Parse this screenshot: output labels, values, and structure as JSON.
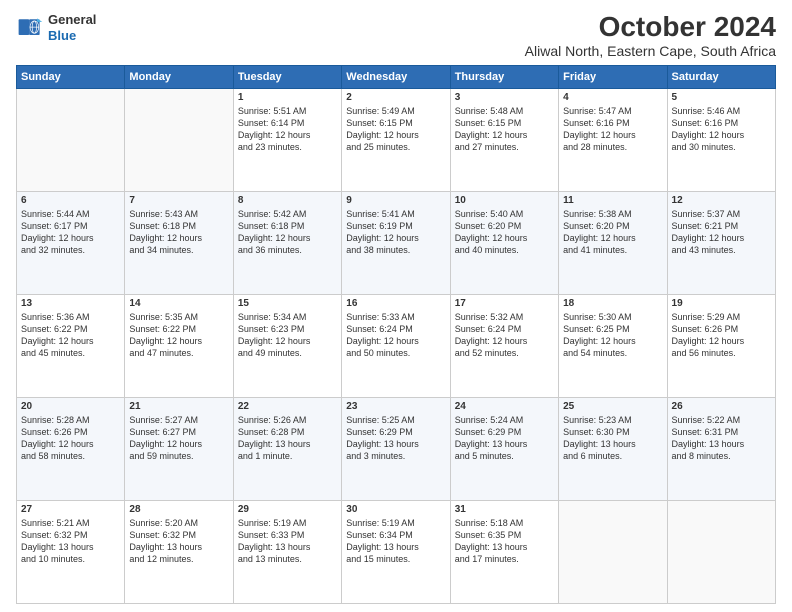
{
  "logo": {
    "line1": "General",
    "line2": "Blue"
  },
  "title": "October 2024",
  "subtitle": "Aliwal North, Eastern Cape, South Africa",
  "headers": [
    "Sunday",
    "Monday",
    "Tuesday",
    "Wednesday",
    "Thursday",
    "Friday",
    "Saturday"
  ],
  "weeks": [
    [
      {
        "day": "",
        "text": ""
      },
      {
        "day": "",
        "text": ""
      },
      {
        "day": "1",
        "text": "Sunrise: 5:51 AM\nSunset: 6:14 PM\nDaylight: 12 hours\nand 23 minutes."
      },
      {
        "day": "2",
        "text": "Sunrise: 5:49 AM\nSunset: 6:15 PM\nDaylight: 12 hours\nand 25 minutes."
      },
      {
        "day": "3",
        "text": "Sunrise: 5:48 AM\nSunset: 6:15 PM\nDaylight: 12 hours\nand 27 minutes."
      },
      {
        "day": "4",
        "text": "Sunrise: 5:47 AM\nSunset: 6:16 PM\nDaylight: 12 hours\nand 28 minutes."
      },
      {
        "day": "5",
        "text": "Sunrise: 5:46 AM\nSunset: 6:16 PM\nDaylight: 12 hours\nand 30 minutes."
      }
    ],
    [
      {
        "day": "6",
        "text": "Sunrise: 5:44 AM\nSunset: 6:17 PM\nDaylight: 12 hours\nand 32 minutes."
      },
      {
        "day": "7",
        "text": "Sunrise: 5:43 AM\nSunset: 6:18 PM\nDaylight: 12 hours\nand 34 minutes."
      },
      {
        "day": "8",
        "text": "Sunrise: 5:42 AM\nSunset: 6:18 PM\nDaylight: 12 hours\nand 36 minutes."
      },
      {
        "day": "9",
        "text": "Sunrise: 5:41 AM\nSunset: 6:19 PM\nDaylight: 12 hours\nand 38 minutes."
      },
      {
        "day": "10",
        "text": "Sunrise: 5:40 AM\nSunset: 6:20 PM\nDaylight: 12 hours\nand 40 minutes."
      },
      {
        "day": "11",
        "text": "Sunrise: 5:38 AM\nSunset: 6:20 PM\nDaylight: 12 hours\nand 41 minutes."
      },
      {
        "day": "12",
        "text": "Sunrise: 5:37 AM\nSunset: 6:21 PM\nDaylight: 12 hours\nand 43 minutes."
      }
    ],
    [
      {
        "day": "13",
        "text": "Sunrise: 5:36 AM\nSunset: 6:22 PM\nDaylight: 12 hours\nand 45 minutes."
      },
      {
        "day": "14",
        "text": "Sunrise: 5:35 AM\nSunset: 6:22 PM\nDaylight: 12 hours\nand 47 minutes."
      },
      {
        "day": "15",
        "text": "Sunrise: 5:34 AM\nSunset: 6:23 PM\nDaylight: 12 hours\nand 49 minutes."
      },
      {
        "day": "16",
        "text": "Sunrise: 5:33 AM\nSunset: 6:24 PM\nDaylight: 12 hours\nand 50 minutes."
      },
      {
        "day": "17",
        "text": "Sunrise: 5:32 AM\nSunset: 6:24 PM\nDaylight: 12 hours\nand 52 minutes."
      },
      {
        "day": "18",
        "text": "Sunrise: 5:30 AM\nSunset: 6:25 PM\nDaylight: 12 hours\nand 54 minutes."
      },
      {
        "day": "19",
        "text": "Sunrise: 5:29 AM\nSunset: 6:26 PM\nDaylight: 12 hours\nand 56 minutes."
      }
    ],
    [
      {
        "day": "20",
        "text": "Sunrise: 5:28 AM\nSunset: 6:26 PM\nDaylight: 12 hours\nand 58 minutes."
      },
      {
        "day": "21",
        "text": "Sunrise: 5:27 AM\nSunset: 6:27 PM\nDaylight: 12 hours\nand 59 minutes."
      },
      {
        "day": "22",
        "text": "Sunrise: 5:26 AM\nSunset: 6:28 PM\nDaylight: 13 hours\nand 1 minute."
      },
      {
        "day": "23",
        "text": "Sunrise: 5:25 AM\nSunset: 6:29 PM\nDaylight: 13 hours\nand 3 minutes."
      },
      {
        "day": "24",
        "text": "Sunrise: 5:24 AM\nSunset: 6:29 PM\nDaylight: 13 hours\nand 5 minutes."
      },
      {
        "day": "25",
        "text": "Sunrise: 5:23 AM\nSunset: 6:30 PM\nDaylight: 13 hours\nand 6 minutes."
      },
      {
        "day": "26",
        "text": "Sunrise: 5:22 AM\nSunset: 6:31 PM\nDaylight: 13 hours\nand 8 minutes."
      }
    ],
    [
      {
        "day": "27",
        "text": "Sunrise: 5:21 AM\nSunset: 6:32 PM\nDaylight: 13 hours\nand 10 minutes."
      },
      {
        "day": "28",
        "text": "Sunrise: 5:20 AM\nSunset: 6:32 PM\nDaylight: 13 hours\nand 12 minutes."
      },
      {
        "day": "29",
        "text": "Sunrise: 5:19 AM\nSunset: 6:33 PM\nDaylight: 13 hours\nand 13 minutes."
      },
      {
        "day": "30",
        "text": "Sunrise: 5:19 AM\nSunset: 6:34 PM\nDaylight: 13 hours\nand 15 minutes."
      },
      {
        "day": "31",
        "text": "Sunrise: 5:18 AM\nSunset: 6:35 PM\nDaylight: 13 hours\nand 17 minutes."
      },
      {
        "day": "",
        "text": ""
      },
      {
        "day": "",
        "text": ""
      }
    ]
  ]
}
